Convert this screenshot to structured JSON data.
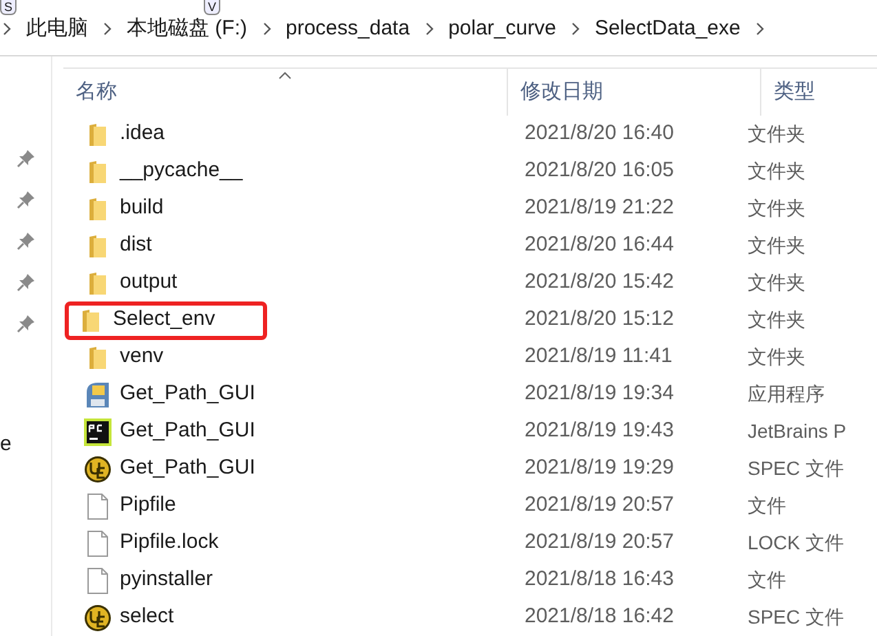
{
  "key_tips": [
    "S",
    "V"
  ],
  "breadcrumb": [
    "此电脑",
    "本地磁盘 (F:)",
    "process_data",
    "polar_curve",
    "SelectData_exe"
  ],
  "nav_pane": {
    "items": [
      {
        "pinned": true
      },
      {
        "pinned": true
      },
      {
        "pinned": true
      },
      {
        "pinned": true
      },
      {
        "pinned": true
      }
    ],
    "partial_label": "e"
  },
  "table": {
    "columns": [
      {
        "label": "名称",
        "sorted": true
      },
      {
        "label": "修改日期",
        "sorted": false
      },
      {
        "label": "类型",
        "sorted": false
      }
    ],
    "rows": [
      {
        "name": ".idea",
        "kind": "folder",
        "date": "2021/8/20 16:40",
        "type": "文件夹",
        "annotated": false
      },
      {
        "name": "__pycache__",
        "kind": "folder",
        "date": "2021/8/20 16:05",
        "type": "文件夹",
        "annotated": false
      },
      {
        "name": "build",
        "kind": "folder",
        "date": "2021/8/19 21:22",
        "type": "文件夹",
        "annotated": false
      },
      {
        "name": "dist",
        "kind": "folder",
        "date": "2021/8/20 16:44",
        "type": "文件夹",
        "annotated": false
      },
      {
        "name": "output",
        "kind": "folder",
        "date": "2021/8/20 15:42",
        "type": "文件夹",
        "annotated": false
      },
      {
        "name": "Select_env",
        "kind": "folder",
        "date": "2021/8/20 15:12",
        "type": "文件夹",
        "annotated": true
      },
      {
        "name": "venv",
        "kind": "folder",
        "date": "2021/8/19 11:41",
        "type": "文件夹",
        "annotated": false
      },
      {
        "name": "Get_Path_GUI",
        "kind": "installer",
        "date": "2021/8/19 19:34",
        "type": "应用程序",
        "annotated": false
      },
      {
        "name": "Get_Path_GUI",
        "kind": "pycharm",
        "date": "2021/8/19 19:43",
        "type": "JetBrains P",
        "annotated": false
      },
      {
        "name": "Get_Path_GUI",
        "kind": "ue",
        "date": "2021/8/19 19:29",
        "type": "SPEC 文件",
        "annotated": false
      },
      {
        "name": "Pipfile",
        "kind": "file",
        "date": "2021/8/19 20:57",
        "type": "文件",
        "annotated": false
      },
      {
        "name": "Pipfile.lock",
        "kind": "file",
        "date": "2021/8/19 20:57",
        "type": "LOCK 文件",
        "annotated": false
      },
      {
        "name": "pyinstaller",
        "kind": "file",
        "date": "2021/8/18 16:43",
        "type": "文件",
        "annotated": false
      },
      {
        "name": "select",
        "kind": "ue",
        "date": "2021/8/18 16:42",
        "type": "SPEC 文件",
        "annotated": false
      }
    ]
  }
}
